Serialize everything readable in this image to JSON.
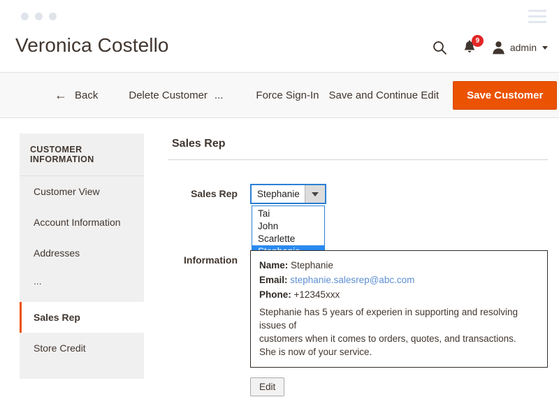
{
  "browser_chrome": {
    "dots": [
      "dot-1",
      "dot-2",
      "dot-3"
    ],
    "menu_icon": "hamburger-menu-icon"
  },
  "header": {
    "page_title": "Veronica Costello",
    "search_icon": "search-icon",
    "notifications": {
      "icon": "bell-icon",
      "count": "9",
      "badge_color": "#e22626"
    },
    "account": {
      "icon": "user-icon",
      "label": "admin",
      "caret": "chevron-down-icon"
    }
  },
  "toolbar": {
    "back_arrow": "←",
    "back_label": "Back",
    "delete_customer_label": "Delete Customer",
    "more_label": "...",
    "force_signin_label": "Force Sign-In",
    "save_and_continue_label": "Save and Continue Edit",
    "save_customer_label": "Save Customer",
    "primary_color": "#eb5202"
  },
  "sidebar": {
    "heading": "CUSTOMER INFORMATION",
    "items": [
      {
        "label": "Customer View",
        "active": false
      },
      {
        "label": "Account Information",
        "active": false
      },
      {
        "label": "Addresses",
        "active": false
      },
      {
        "label": "...",
        "active": false
      },
      {
        "label": "Sales Rep",
        "active": true
      },
      {
        "label": "Store Credit",
        "active": false
      }
    ],
    "active_marker_color": "#eb5202"
  },
  "content": {
    "section_title": "Sales Rep",
    "sales_rep_field": {
      "label": "Sales Rep",
      "selected_value": "Stephanie",
      "dropdown_open": true,
      "arrow_icon": "caret-down-icon",
      "options": [
        {
          "label": "Tai",
          "selected": false
        },
        {
          "label": "John",
          "selected": false
        },
        {
          "label": "Scarlette",
          "selected": false
        },
        {
          "label": "Stephanie",
          "selected": true
        }
      ],
      "highlight_color": "#2a8af0",
      "border_color": "#2a7fd4"
    },
    "information_field": {
      "label": "Information",
      "name_label": "Name:",
      "name_value": "Stephanie",
      "email_label": "Email:",
      "email_value": "stephanie.salesrep@abc.com",
      "email_color": "#5d8fd1",
      "phone_label": "Phone:",
      "phone_value": "+12345xxx",
      "description_line_1": "Stephanie has 5 years of experien in supporting and resolving issues of",
      "description_line_2": "customers when it comes to orders, quotes, and transactions.",
      "description_line_3": "She is now of your service."
    },
    "edit_button_label": "Edit"
  }
}
